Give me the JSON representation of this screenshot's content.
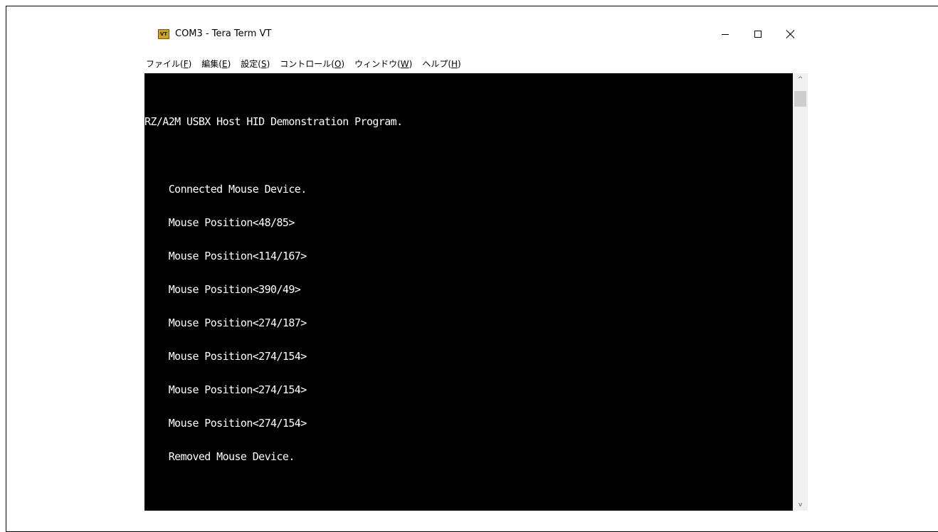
{
  "window": {
    "title": "COM3 - Tera Term VT",
    "icon": "tera-term-vt-icon",
    "icon_label": "VT",
    "controls": {
      "minimize_icon": "minimize-icon",
      "maximize_icon": "maximize-icon",
      "close_icon": "close-icon"
    }
  },
  "menubar": {
    "items": [
      {
        "label": "ファイル(",
        "mnemonic": "F",
        "suffix": ")"
      },
      {
        "label": "編集(",
        "mnemonic": "E",
        "suffix": ")"
      },
      {
        "label": "設定(",
        "mnemonic": "S",
        "suffix": ")"
      },
      {
        "label": "コントロール(",
        "mnemonic": "O",
        "suffix": ")"
      },
      {
        "label": "ウィンドウ(",
        "mnemonic": "W",
        "suffix": ")"
      },
      {
        "label": "ヘルプ(",
        "mnemonic": "H",
        "suffix": ")"
      }
    ]
  },
  "terminal": {
    "background": "#000000",
    "foreground": "#ffffff",
    "lines": [
      "RZ/A2M USBX Host HID Demonstration Program.",
      "",
      "    Connected Mouse Device.",
      "    Mouse Position<48/85>",
      "    Mouse Position<114/167>",
      "    Mouse Position<390/49>",
      "    Mouse Position<274/187>",
      "    Mouse Position<274/154>",
      "    Mouse Position<274/154>",
      "    Mouse Position<274/154>",
      "    Removed Mouse Device."
    ]
  },
  "scrollbar": {
    "up_icon": "scroll-up-arrow-icon",
    "down_icon": "scroll-down-arrow-icon",
    "up_glyph": "^",
    "down_glyph": "v"
  }
}
